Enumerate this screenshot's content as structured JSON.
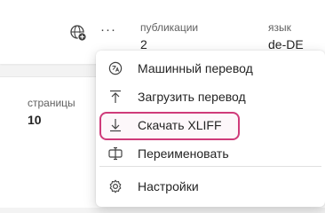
{
  "header": {
    "globe_icon": "globe-add-icon",
    "more_label": "···",
    "publications": {
      "label": "публикации",
      "value": "2"
    },
    "language": {
      "label": "язык",
      "value": "de-DE"
    }
  },
  "details": {
    "pages": {
      "label": "страницы",
      "value": "10"
    }
  },
  "menu": {
    "items": [
      {
        "label": "Машинный перевод",
        "icon": "translate-icon"
      },
      {
        "label": "Загрузить перевод",
        "icon": "upload-icon"
      },
      {
        "label": "Скачать XLIFF",
        "icon": "download-icon"
      },
      {
        "label": "Переименовать",
        "icon": "rename-icon"
      },
      {
        "label": "Настройки",
        "icon": "gear-icon"
      }
    ],
    "highlight_color": "#cf3b7a"
  }
}
